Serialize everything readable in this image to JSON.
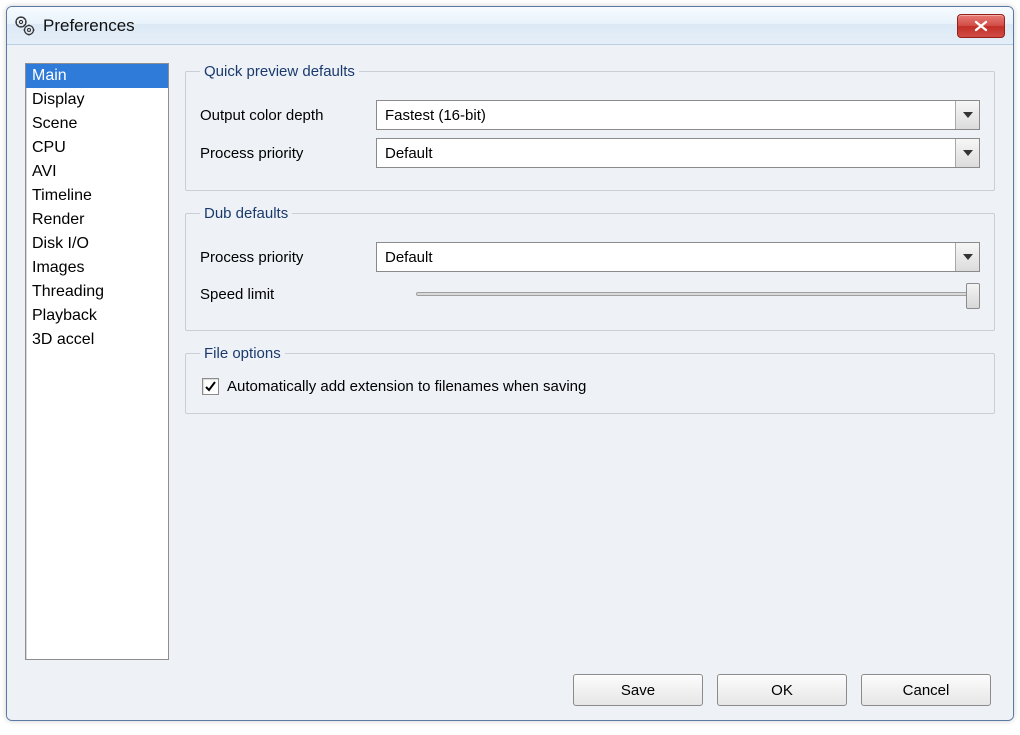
{
  "window": {
    "title": "Preferences"
  },
  "sidebar": {
    "items": [
      {
        "label": "Main",
        "selected": true
      },
      {
        "label": "Display",
        "selected": false
      },
      {
        "label": "Scene",
        "selected": false
      },
      {
        "label": "CPU",
        "selected": false
      },
      {
        "label": "AVI",
        "selected": false
      },
      {
        "label": "Timeline",
        "selected": false
      },
      {
        "label": "Render",
        "selected": false
      },
      {
        "label": "Disk I/O",
        "selected": false
      },
      {
        "label": "Images",
        "selected": false
      },
      {
        "label": "Threading",
        "selected": false
      },
      {
        "label": "Playback",
        "selected": false
      },
      {
        "label": "3D accel",
        "selected": false
      }
    ]
  },
  "quick_preview": {
    "legend": "Quick preview defaults",
    "output_color_depth": {
      "label": "Output color depth",
      "value": "Fastest (16-bit)"
    },
    "process_priority": {
      "label": "Process priority",
      "value": "Default"
    }
  },
  "dub": {
    "legend": "Dub defaults",
    "process_priority": {
      "label": "Process priority",
      "value": "Default"
    },
    "speed_limit": {
      "label": "Speed limit",
      "position_pct": 100
    }
  },
  "file_options": {
    "legend": "File options",
    "auto_ext": {
      "label": "Automatically add extension to filenames when saving",
      "checked": true
    }
  },
  "buttons": {
    "save": "Save",
    "ok": "OK",
    "cancel": "Cancel"
  }
}
